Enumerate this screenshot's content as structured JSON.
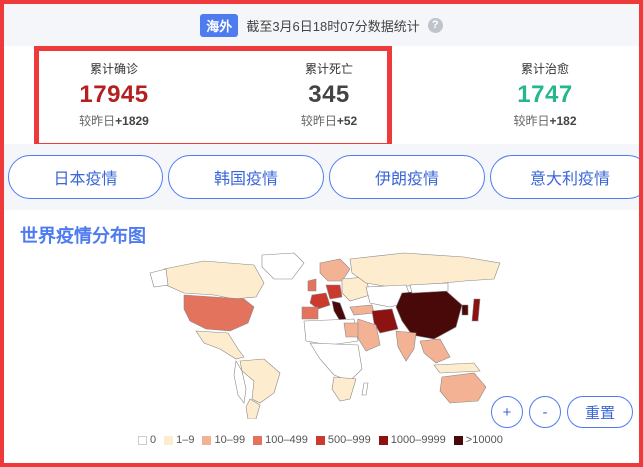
{
  "header": {
    "badge": "海外",
    "update_text": "截至3月6日18时07分数据统计",
    "help_glyph": "?"
  },
  "stats": [
    {
      "label": "累计确诊",
      "value": "17945",
      "delta_label": "较昨日",
      "delta": "+1829",
      "color": "#b51f1f"
    },
    {
      "label": "累计死亡",
      "value": "345",
      "delta_label": "较昨日",
      "delta": "+52",
      "color": "#444444"
    },
    {
      "label": "累计治愈",
      "value": "1747",
      "delta_label": "较昨日",
      "delta": "+182",
      "color": "#28b68e"
    }
  ],
  "tabs": [
    {
      "label": "日本疫情"
    },
    {
      "label": "韩国疫情"
    },
    {
      "label": "伊朗疫情"
    },
    {
      "label": "意大利疫情"
    }
  ],
  "map": {
    "title": "世界疫情分布图",
    "zoom_in": "+",
    "zoom_out": "-",
    "reset": "重置",
    "legend": [
      {
        "label": "0",
        "color": "#ffffff"
      },
      {
        "label": "1–9",
        "color": "#fdeccd"
      },
      {
        "label": "10–99",
        "color": "#f4b294"
      },
      {
        "label": "100–499",
        "color": "#e4735d"
      },
      {
        "label": "500–999",
        "color": "#cc3a2e"
      },
      {
        "label": "1000–9999",
        "color": "#8c1312"
      },
      {
        "label": ">10000",
        "color": "#4a0909"
      }
    ]
  }
}
